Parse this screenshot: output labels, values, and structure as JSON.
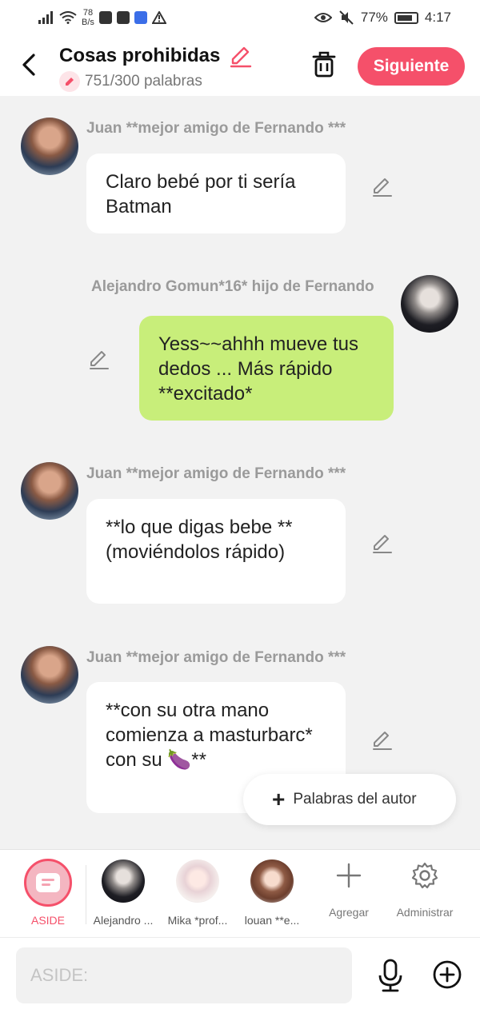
{
  "status_bar": {
    "net_speed_value": "78",
    "net_speed_unit": "B/s",
    "battery": "77%",
    "time": "4:17"
  },
  "header": {
    "title": "Cosas prohibidas",
    "word_count": "751/300 palabras",
    "next_label": "Siguiente"
  },
  "messages": [
    {
      "author": "Juan **mejor amigo de Fernando ***",
      "text": "Claro bebé por ti sería Batman",
      "side": "left"
    },
    {
      "author": "Alejandro Gomun*16* hijo de Fernando",
      "text": "Yess~~ahhh mueve tus dedos ... Más rápido **excitado*",
      "side": "right"
    },
    {
      "author": "Juan **mejor amigo de Fernando ***",
      "text": "**lo que digas bebe **(moviéndolos rápido)",
      "side": "left"
    },
    {
      "author": "Juan **mejor amigo de Fernando ***",
      "text": "**con su otra mano comienza a masturbarc* con su 🍆**",
      "side": "left"
    }
  ],
  "author_words_label": "Palabras del autor",
  "character_bar": {
    "aside_label": "ASIDE",
    "characters": [
      {
        "label": "Alejandro ..."
      },
      {
        "label": "Mika *prof..."
      },
      {
        "label": "louan **e..."
      }
    ],
    "add_label": "Agregar",
    "manage_label": "Administrar"
  },
  "input": {
    "placeholder": "ASIDE:"
  },
  "colors": {
    "accent": "#f5506a",
    "own_bubble": "#c8ee7a",
    "background": "#f2f2f2"
  },
  "icons": [
    "back-arrow-icon",
    "pencil-icon",
    "trash-icon",
    "plus-icon",
    "gear-icon",
    "microphone-icon",
    "plus-circle-icon",
    "eye-icon",
    "mute-icon",
    "wifi-icon",
    "signal-icon"
  ]
}
